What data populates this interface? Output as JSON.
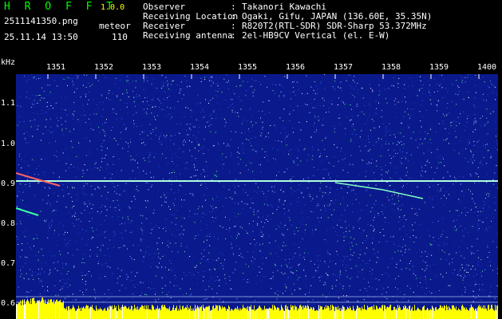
{
  "header": {
    "title": "H R O F F T",
    "version": "1.0.0",
    "filename": "2511141350.png",
    "datetime": "25.11.14 13:50",
    "meteor_label": "meteor",
    "meteor_count": "110"
  },
  "info": [
    {
      "key": "Observer",
      "value": "Takanori Kawachi"
    },
    {
      "key": "Receiving Location",
      "value": "Ogaki, Gifu, JAPAN (136.60E, 35.35N)"
    },
    {
      "key": "Receiver",
      "value": "R820T2(RTL-SDR) SDR-Sharp 53.372MHz"
    },
    {
      "key": "Receiving antenna",
      "value": "2el-HB9CV Vertical (el. E-W)"
    }
  ],
  "axis": {
    "y_unit": "kHz",
    "x_ticks": [
      "1351",
      "1352",
      "1353",
      "1354",
      "1355",
      "1356",
      "1357",
      "1358",
      "1359",
      "1400"
    ],
    "y_ticks": [
      "1.1",
      "1.0",
      "0.9",
      "0.8",
      "0.7",
      "0.6"
    ]
  },
  "colors": {
    "background": "#0a1a8c",
    "carrier": "#b0ffe0",
    "noise_floor": "#ffff00",
    "title": "#00ff00"
  }
}
